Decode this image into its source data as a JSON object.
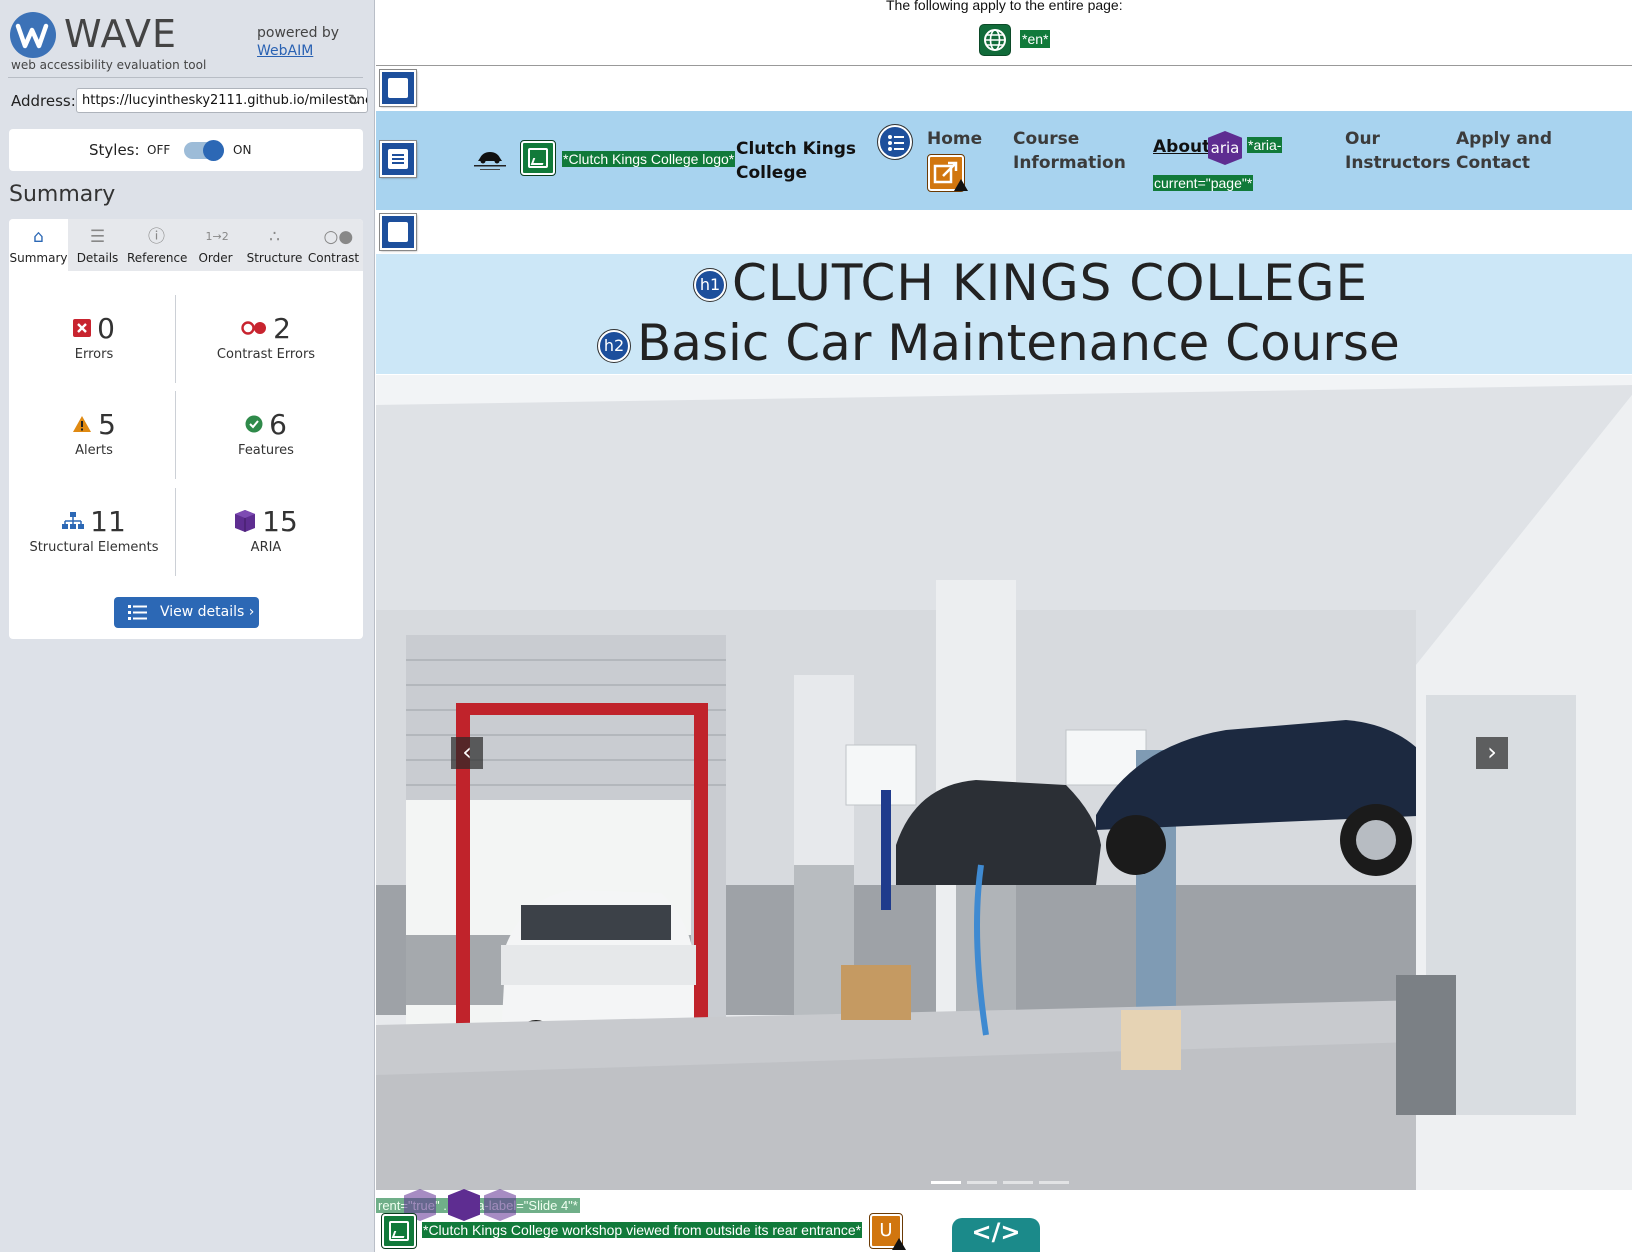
{
  "wave": {
    "brand_name": "WAVE",
    "brand_sub": "web accessibility evaluation tool",
    "powered_by": "powered by",
    "powered_link": "WebAIM",
    "address_label": "Address:",
    "address_value": "https://lucyinthesky2111.github.io/milestone",
    "styles_label": "Styles:",
    "styles_off": "OFF",
    "styles_on": "ON",
    "summary_title": "Summary",
    "tabs": [
      {
        "label": "Summary",
        "icon": "home-icon"
      },
      {
        "label": "Details",
        "icon": "list-icon"
      },
      {
        "label": "Reference",
        "icon": "info-icon"
      },
      {
        "label": "Order",
        "icon": "order-icon"
      },
      {
        "label": "Structure",
        "icon": "structure-icon"
      },
      {
        "label": "Contrast",
        "icon": "contrast-icon"
      }
    ],
    "stats": {
      "errors": {
        "value": "0",
        "label": "Errors",
        "color": "#c8242f"
      },
      "contrast_errors": {
        "value": "2",
        "label": "Contrast Errors",
        "color": "#c8242f"
      },
      "alerts": {
        "value": "5",
        "label": "Alerts",
        "color": "#e08a12"
      },
      "features": {
        "value": "6",
        "label": "Features",
        "color": "#2f8a4a"
      },
      "structural": {
        "value": "11",
        "label": "Structural Elements",
        "color": "#2c68b5"
      },
      "aria": {
        "value": "15",
        "label": "ARIA",
        "color": "#5e2d91"
      }
    },
    "view_details": "View details ›"
  },
  "page": {
    "apply_text": "The following apply to the entire page:",
    "lang_tag": "*en*",
    "logo_alt": "*Clutch Kings College logo*",
    "site_name_1": "Clutch Kings",
    "site_name_2": "College",
    "nav": {
      "home": "Home",
      "course_1": "Course",
      "course_2": "Information",
      "about": "About",
      "aria_label": "aria",
      "aria_current_1": "*aria-",
      "aria_current_2": "current=\"page\"*",
      "instructors_1": "Our",
      "instructors_2": "Instructors",
      "apply_1": "Apply and",
      "apply_2": "Contact"
    },
    "h1_badge": "h1",
    "h1": "CLUTCH KINGS COLLEGE",
    "h2_badge": "h2",
    "h2": "Basic Car Maintenance Course",
    "hidden_tags": "rent=\"true\"  ... *aria-label=\"Slide 4\"*",
    "hero_alt": "*Clutch Kings College workshop viewed from outside its rear entrance*",
    "underline_icon": "U",
    "code_btn": "</>"
  },
  "colors": {
    "wave_blue": "#2c68b5",
    "nav_band": "#a8d3ef",
    "head_band": "#cce7f7",
    "feature_green": "#117a3a",
    "aria_purple": "#5e2d91",
    "alert_orange": "#d1760f"
  }
}
